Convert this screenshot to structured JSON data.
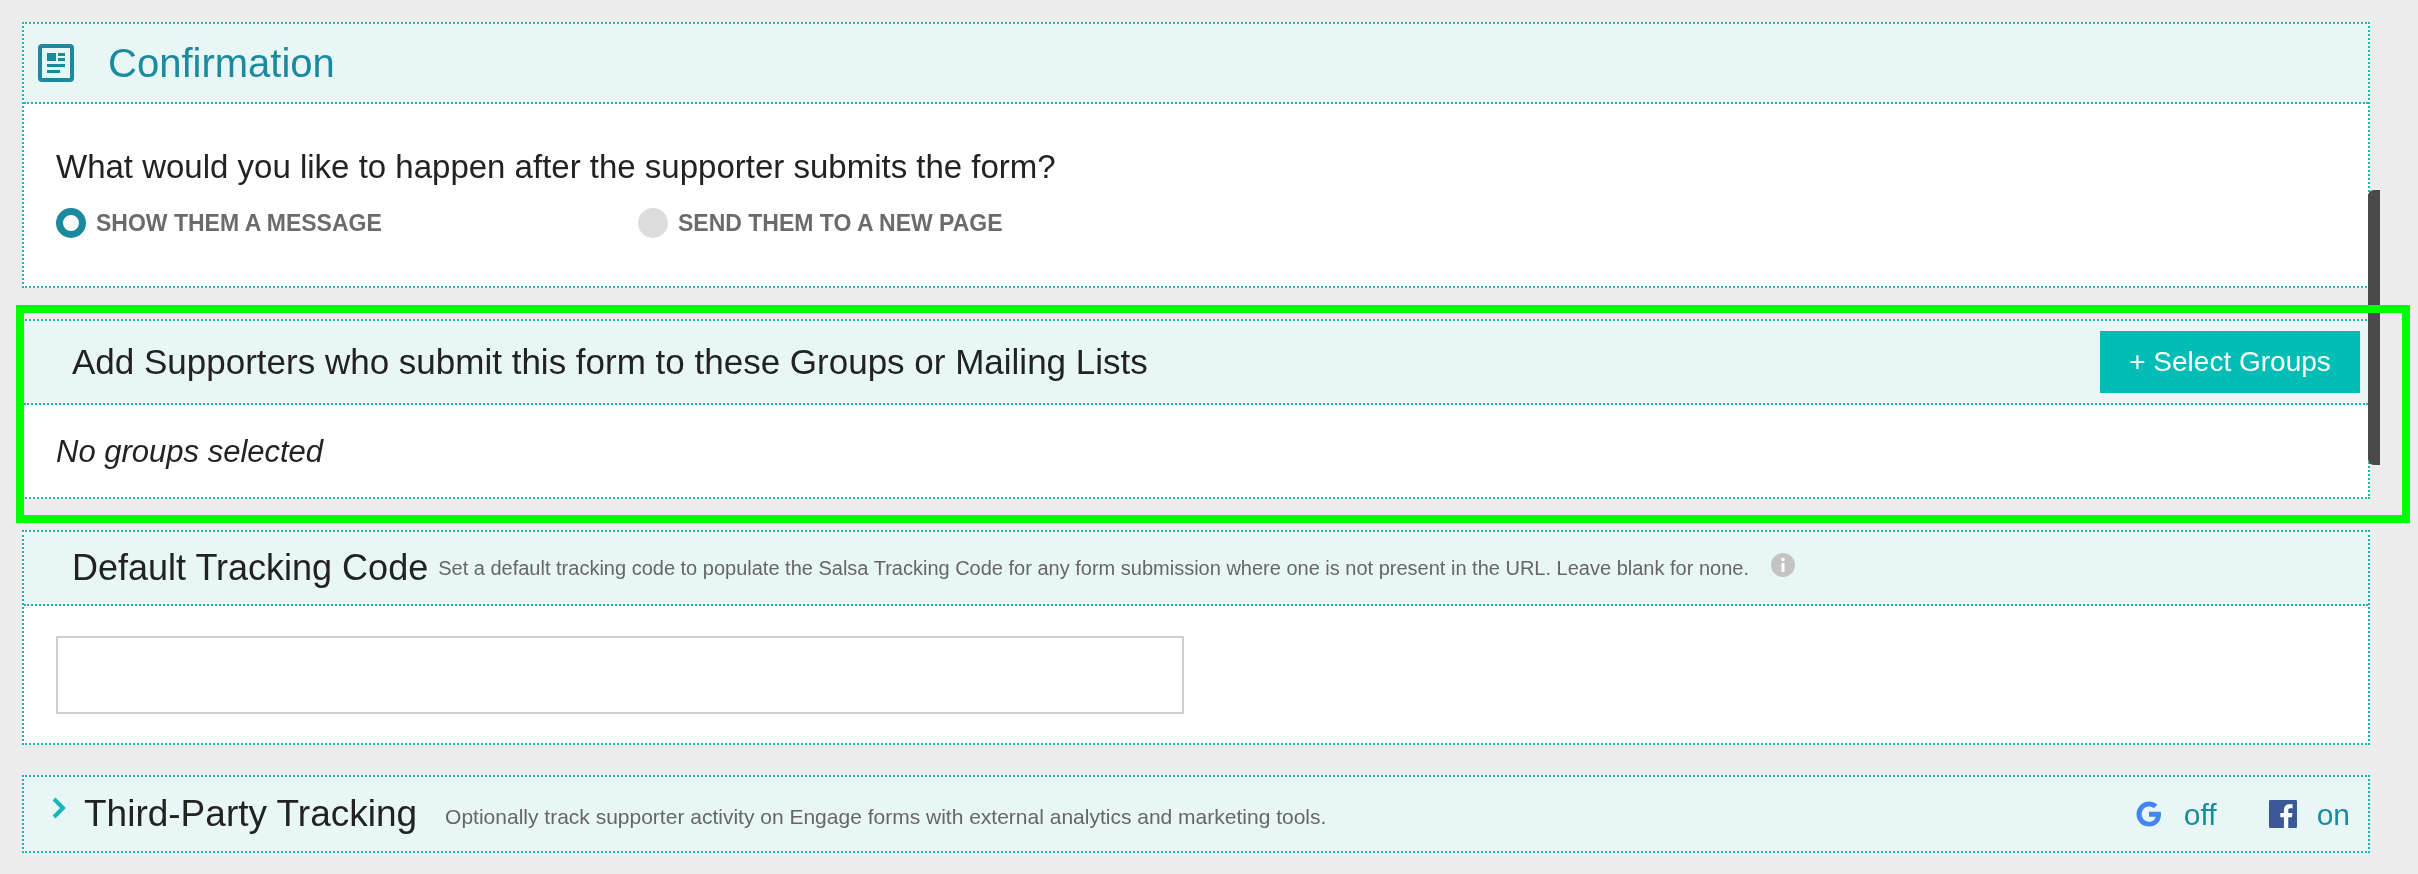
{
  "confirmation": {
    "title": "Confirmation",
    "question": "What would you like to happen after the supporter submits the form?",
    "options": [
      {
        "label": "SHOW THEM A MESSAGE",
        "selected": true
      },
      {
        "label": "SEND THEM TO A NEW PAGE",
        "selected": false
      }
    ]
  },
  "groups": {
    "title": "Add Supporters who submit this form to these Groups or Mailing Lists",
    "button": "+ Select Groups",
    "empty_text": "No groups selected"
  },
  "tracking": {
    "title": "Default Tracking Code",
    "description": "Set a default tracking code to populate the Salsa Tracking Code for any form submission where one is not present in the URL. Leave blank for none."
  },
  "third_party": {
    "title": "Third-Party Tracking",
    "description": "Optionally track supporter activity on Engage forms with external analytics and marketing tools.",
    "expanded": false,
    "services": [
      {
        "kind": "google",
        "status": "off"
      },
      {
        "kind": "facebook",
        "status": "on"
      }
    ]
  }
}
